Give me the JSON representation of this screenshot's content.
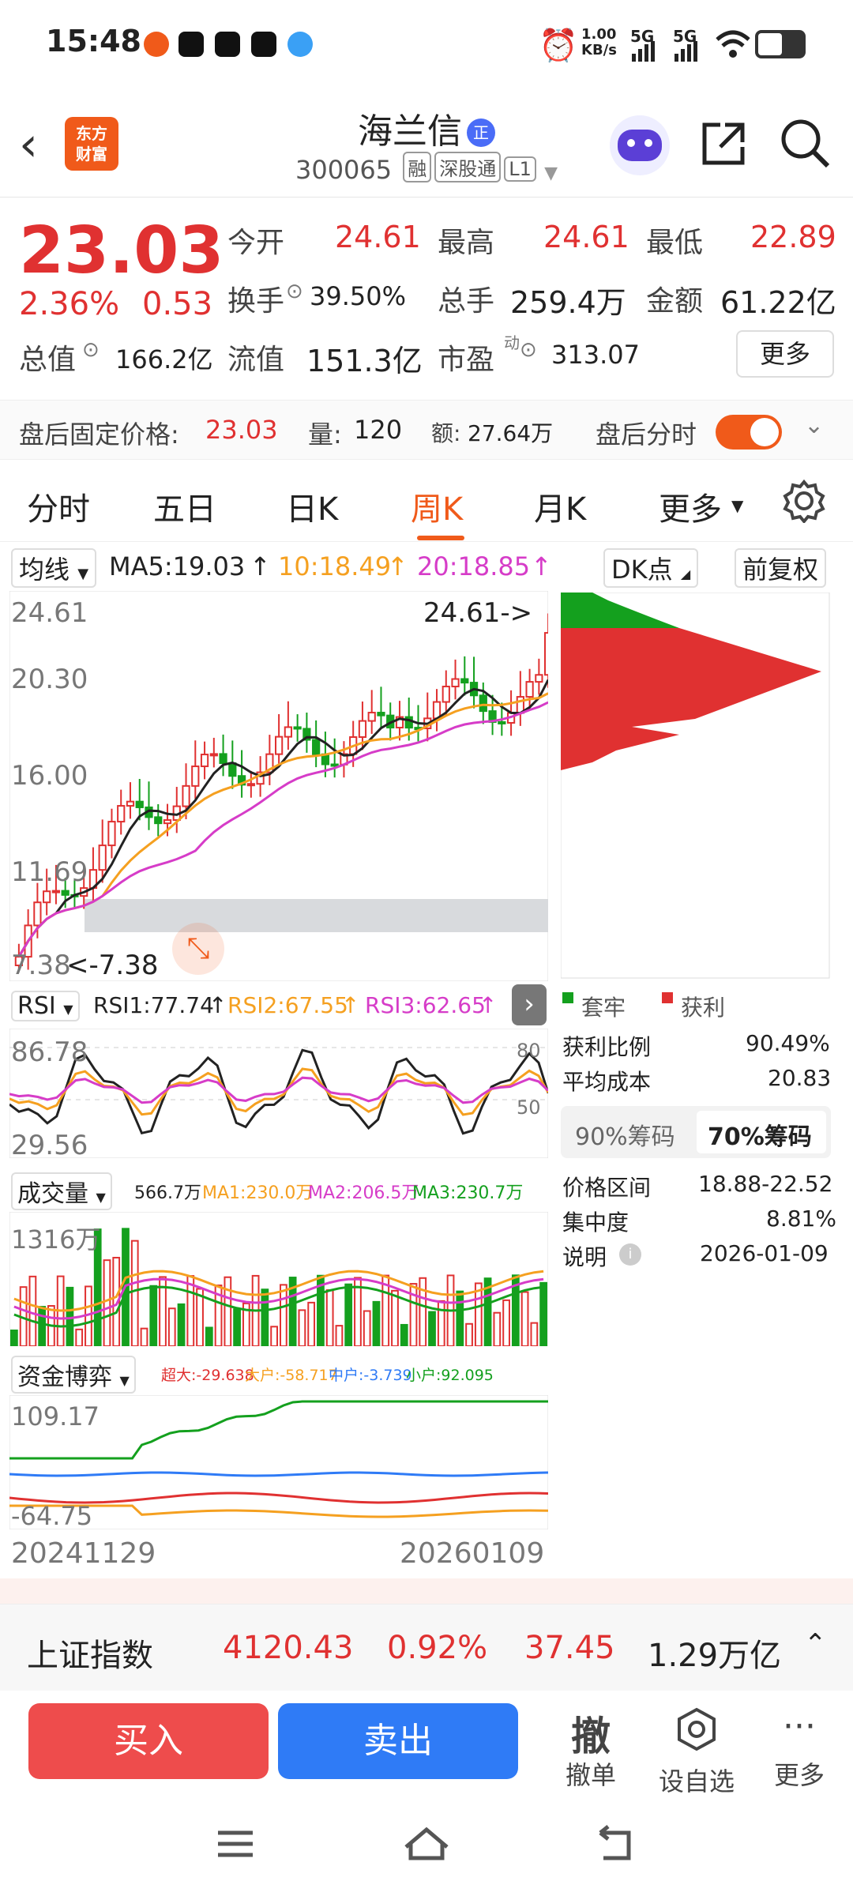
{
  "status_bar": {
    "time": "15:48",
    "net_speed": "1.00 KB/s",
    "sig1": "5G",
    "sig2": "5G"
  },
  "header": {
    "back_icon": "back-arrow-icon",
    "logo_text": "东方\n财富",
    "stock_name": "海兰信",
    "badge": "正",
    "code": "300065",
    "tags": [
      "融",
      "深股通",
      "L1"
    ]
  },
  "quote": {
    "price": "23.03",
    "change_pct": "2.36%",
    "change": "0.53",
    "open_label": "今开",
    "open": "24.61",
    "high_label": "最高",
    "high": "24.61",
    "low_label": "最低",
    "low": "22.89",
    "turnover_label": "换手",
    "turnover": "39.50%",
    "volume_label": "总手",
    "volume": "259.4万",
    "amount_label": "金额",
    "amount": "61.22亿",
    "mcap_label": "总值",
    "mcap": "166.2亿",
    "float_label": "流值",
    "float": "151.3亿",
    "pe_label": "市盈",
    "pe_sup": "动",
    "pe": "313.07",
    "more": "更多"
  },
  "after_hours": {
    "price_label": "盘后固定价格:",
    "price": "23.03",
    "vol_label": "量:",
    "vol": "120",
    "amt_label": "额:",
    "amt": "27.64万",
    "toggle_label": "盘后分时"
  },
  "tabs": [
    "分时",
    "五日",
    "日K",
    "周K",
    "月K",
    "更多"
  ],
  "active_tab": "周K",
  "kline": {
    "ma_selector": "均线",
    "ma5": "MA5:19.03",
    "ma10": "10:18.49",
    "ma20": "20:18.85",
    "dk_button": "DK点",
    "adjust_button": "前复权",
    "y_labels": [
      "24.61",
      "20.30",
      "16.00",
      "11.69",
      "7.38"
    ],
    "max_marker": "24.61->",
    "min_marker": "<-7.38"
  },
  "chips": {
    "legend_trap": "套牢",
    "legend_profit": "获利",
    "profit_ratio_label": "获利比例",
    "profit_ratio": "90.49%",
    "avg_cost_label": "平均成本",
    "avg_cost": "20.83",
    "tab90": "90%筹码",
    "tab70": "70%筹码",
    "range_label": "价格区间",
    "range": "18.88-22.52",
    "conc_label": "集中度",
    "conc": "8.81%",
    "note_label": "说明",
    "note": "2026-01-09"
  },
  "rsi": {
    "selector": "RSI",
    "rsi1": "RSI1:77.74",
    "rsi2": "RSI2:67.55",
    "rsi3": "RSI3:62.65",
    "top": "86.78",
    "bottom": "29.56",
    "r80": "80",
    "r50": "50"
  },
  "volume": {
    "selector": "成交量",
    "v": "566.7万",
    "ma1": "MA1:230.0万",
    "ma2": "MA2:206.5万",
    "ma3": "MA3:230.7万",
    "top": "1316万"
  },
  "capital": {
    "selector": "资金博弈",
    "super": "超大:-29.638",
    "large": "大户:-58.717",
    "mid": "中户:-3.739",
    "small": "小户:92.095",
    "top": "109.17",
    "bottom": "-64.75"
  },
  "dates": {
    "start": "20241129",
    "end": "20260109"
  },
  "index_bar": {
    "name": "上证指数",
    "value": "4120.43",
    "pct": "0.92%",
    "change": "37.45",
    "amount": "1.29万亿"
  },
  "trade": {
    "buy": "买入",
    "sell": "卖出",
    "cancel_icon": "撤",
    "cancel": "撤单",
    "watch": "设自选",
    "more": "更多"
  },
  "colors": {
    "red": "#e03131",
    "green": "#14a01e",
    "orange": "#f5a020",
    "magenta": "#d63cc8",
    "accent": "#f05a1a",
    "blue": "#2f7bf6"
  }
}
